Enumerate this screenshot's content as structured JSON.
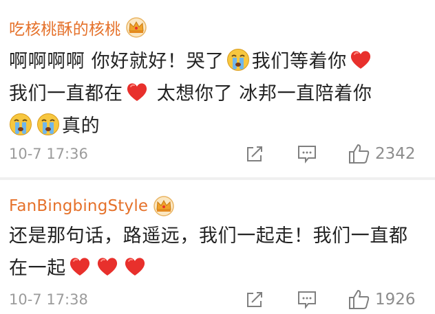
{
  "comments": [
    {
      "username": "吃核桃酥的核桃",
      "text_parts": [
        "啊啊啊啊 你好就好！哭了",
        "我们等着你",
        "我们一直都在",
        " 太想你了 冰邦一直陪着你",
        "真的"
      ],
      "time": "10-7 17:36",
      "likes": "2342"
    },
    {
      "username": "FanBingbingStyle",
      "text_parts": [
        "还是那句话，路遥远，我们一起走！我们一直都在一起"
      ],
      "time": "10-7 17:38",
      "likes": "1926"
    }
  ],
  "icons": {
    "crown": "crown-badge-icon",
    "cry": "crying-face-emoji",
    "heart": "red-heart-emoji",
    "share": "share-icon",
    "reply": "comment-icon",
    "like": "thumbs-up-icon"
  },
  "colors": {
    "username": "#e5712a",
    "heart": "#e8302c",
    "meta": "#9b9b9b"
  }
}
